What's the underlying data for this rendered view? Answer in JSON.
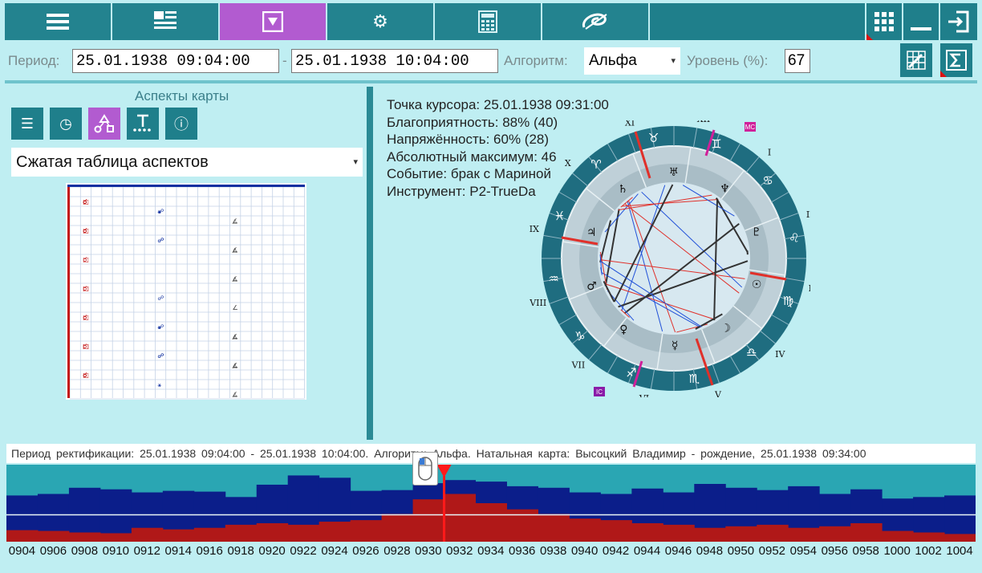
{
  "toolbar": {
    "buttons": [
      "list-icon",
      "grid-lines-icon",
      "download-box-icon",
      "gear-icon",
      "calculator-icon",
      "logo-icon"
    ],
    "right_buttons": [
      "apps-grid-icon",
      "minimize-icon",
      "exit-icon"
    ]
  },
  "params": {
    "period_label": "Период:",
    "period_from": "25.01.1938 09:04:00",
    "period_sep": "-",
    "period_to": "25.01.1938 10:04:00",
    "algorithm_label": "Алгоритм:",
    "algorithm_value": "Альфа",
    "level_label": "Уровень (%):",
    "level_value": "67"
  },
  "left_panel": {
    "title": "Аспекты карты",
    "dropdown_value": "Сжатая таблица аспектов"
  },
  "info": {
    "cursor_point": "Точка курсора: 25.01.1938 09:31:00",
    "favorability": "Благоприятность: 88% (40)",
    "tension": "Напряжённость: 60% (28)",
    "absolute_max": "Абсолютный максимум: 46",
    "event": "Событие: брак с Мариной",
    "instrument": "Инструмент: P2-TrueDa"
  },
  "chart_labels": {
    "mc": "MC",
    "ic": "IC",
    "houses": [
      "XI",
      "XII",
      "I",
      "II",
      "III",
      "IV",
      "V",
      "VI",
      "VII",
      "VIII",
      "IX",
      "X"
    ]
  },
  "bottom": {
    "status": "Период ректификации: 25.01.1938 09:04:00 - 25.01.1938 10:04:00. Алгоритм: Альфа. Натальная карта: Высоцкий Владимир - рождение, 25.01.1938 09:34:00",
    "ticks": [
      "0904",
      "0906",
      "0908",
      "0910",
      "0912",
      "0914",
      "0916",
      "0918",
      "0920",
      "0922",
      "0924",
      "0926",
      "0928",
      "0930",
      "0932",
      "0934",
      "0936",
      "0938",
      "0940",
      "0942",
      "0944",
      "0946",
      "0948",
      "0950",
      "0952",
      "0954",
      "0956",
      "0958",
      "1000",
      "1002",
      "1004"
    ]
  },
  "chart_data": {
    "type": "bar",
    "categories": [
      "0904",
      "0906",
      "0908",
      "0910",
      "0912",
      "0914",
      "0916",
      "0918",
      "0920",
      "0922",
      "0924",
      "0926",
      "0928",
      "0930",
      "0932",
      "0934",
      "0936",
      "0938",
      "0940",
      "0942",
      "0944",
      "0946",
      "0948",
      "0950",
      "0952",
      "0954",
      "0956",
      "0958",
      "1000",
      "1002",
      "1004"
    ],
    "series": [
      {
        "values": [
          60,
          62,
          70,
          68,
          64,
          66,
          65,
          58,
          74,
          86,
          83,
          66,
          67,
          76,
          80,
          78,
          72,
          70,
          64,
          62,
          69,
          64,
          75,
          70,
          67,
          72,
          62,
          68,
          56,
          58,
          60
        ]
      },
      {
        "values": [
          15,
          14,
          12,
          11,
          18,
          16,
          18,
          22,
          24,
          22,
          26,
          28,
          36,
          55,
          62,
          50,
          42,
          36,
          30,
          28,
          24,
          22,
          18,
          20,
          22,
          18,
          20,
          24,
          14,
          12,
          10
        ]
      }
    ],
    "colors": [
      "#0b1e8a",
      "#b01818"
    ],
    "cursor_time": "0931",
    "threshold_percent": 67
  },
  "colors": {
    "accent": "#1f7f8b",
    "active": "#b25bd0",
    "bg": "#bfeef2"
  }
}
